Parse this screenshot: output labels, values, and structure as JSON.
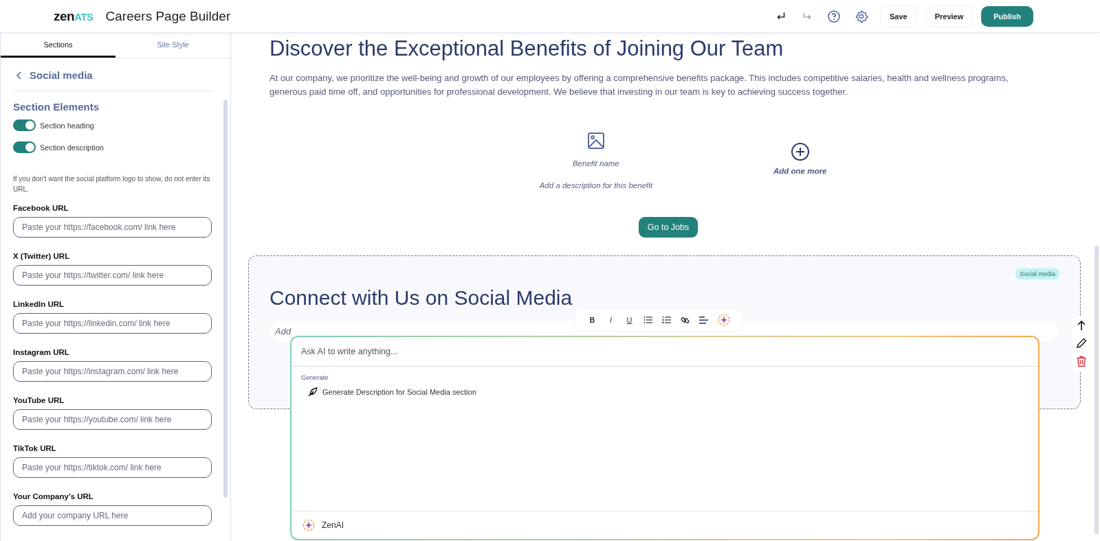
{
  "header": {
    "logo": {
      "word": "zen",
      "accent": "ATS"
    },
    "title": "Careers Page Builder",
    "undo": {
      "disabled": false
    },
    "redo": {
      "disabled": true
    },
    "buttons": [
      {
        "label": "Save",
        "kind": "secondary"
      },
      {
        "label": "Preview",
        "kind": "secondary"
      },
      {
        "label": "Publish",
        "kind": "primary"
      }
    ]
  },
  "sidebar": {
    "tabs": [
      {
        "label": "Sections",
        "selected": true
      },
      {
        "label": "Site Style",
        "selected": false
      }
    ],
    "back_label": "Social media",
    "section_elements": {
      "title": "Section Elements",
      "toggles": [
        {
          "label": "Section heading",
          "on": true
        },
        {
          "label": "Section description",
          "on": true
        }
      ]
    },
    "note": "If you don't want the social platform logo to show, do not enter its URL.",
    "fields": [
      {
        "label": "Facebook URL",
        "placeholder": "Paste your https://facebook.com/ link here"
      },
      {
        "label": "X (Twitter) URL",
        "placeholder": "Paste your https://twitter.com/ link here"
      },
      {
        "label": "LinkedIn URL",
        "placeholder": "Paste your https://linkedin.com/ link here"
      },
      {
        "label": "Instagram URL",
        "placeholder": "Paste your https://instagram.com/ link here"
      },
      {
        "label": "YouTube URL",
        "placeholder": "Paste your https://youtube.com/ link here"
      },
      {
        "label": "TikTok URL",
        "placeholder": "Paste your https://tiktok.com/ link here"
      },
      {
        "label": "Your Company's URL",
        "placeholder": "Add your company URL here"
      }
    ]
  },
  "benefits": {
    "heading": "Discover the Exceptional Benefits of Joining Our Team",
    "description": "At our company, we prioritize the well-being and growth of our employees by offering a comprehensive benefits package. This includes competitive salaries, health and wellness programs, generous paid time off, and opportunities for professional development. We believe that investing in our team is key to achieving success together.",
    "items": [
      {
        "name": "Benefit name",
        "description": "Add a description for this benefit"
      }
    ],
    "add_label": "Add one more",
    "button": "Go to Jobs"
  },
  "social": {
    "badge": "Social media",
    "heading": "Connect with Us on Social Media",
    "description_placeholder": "Add",
    "toolbar": [
      {
        "kind": "bold",
        "label": "B"
      },
      {
        "kind": "italic",
        "label": "I"
      },
      {
        "kind": "underline",
        "label": "U"
      },
      {
        "kind": "bullets"
      },
      {
        "kind": "numbers"
      },
      {
        "kind": "link"
      },
      {
        "kind": "align"
      },
      {
        "kind": "ai"
      }
    ]
  },
  "ai_popup": {
    "placeholder": "Ask AI to write anything...",
    "group_label": "Generate",
    "suggestions": [
      "Generate Description for Social Media section"
    ],
    "footer_label": "ZenAI"
  }
}
